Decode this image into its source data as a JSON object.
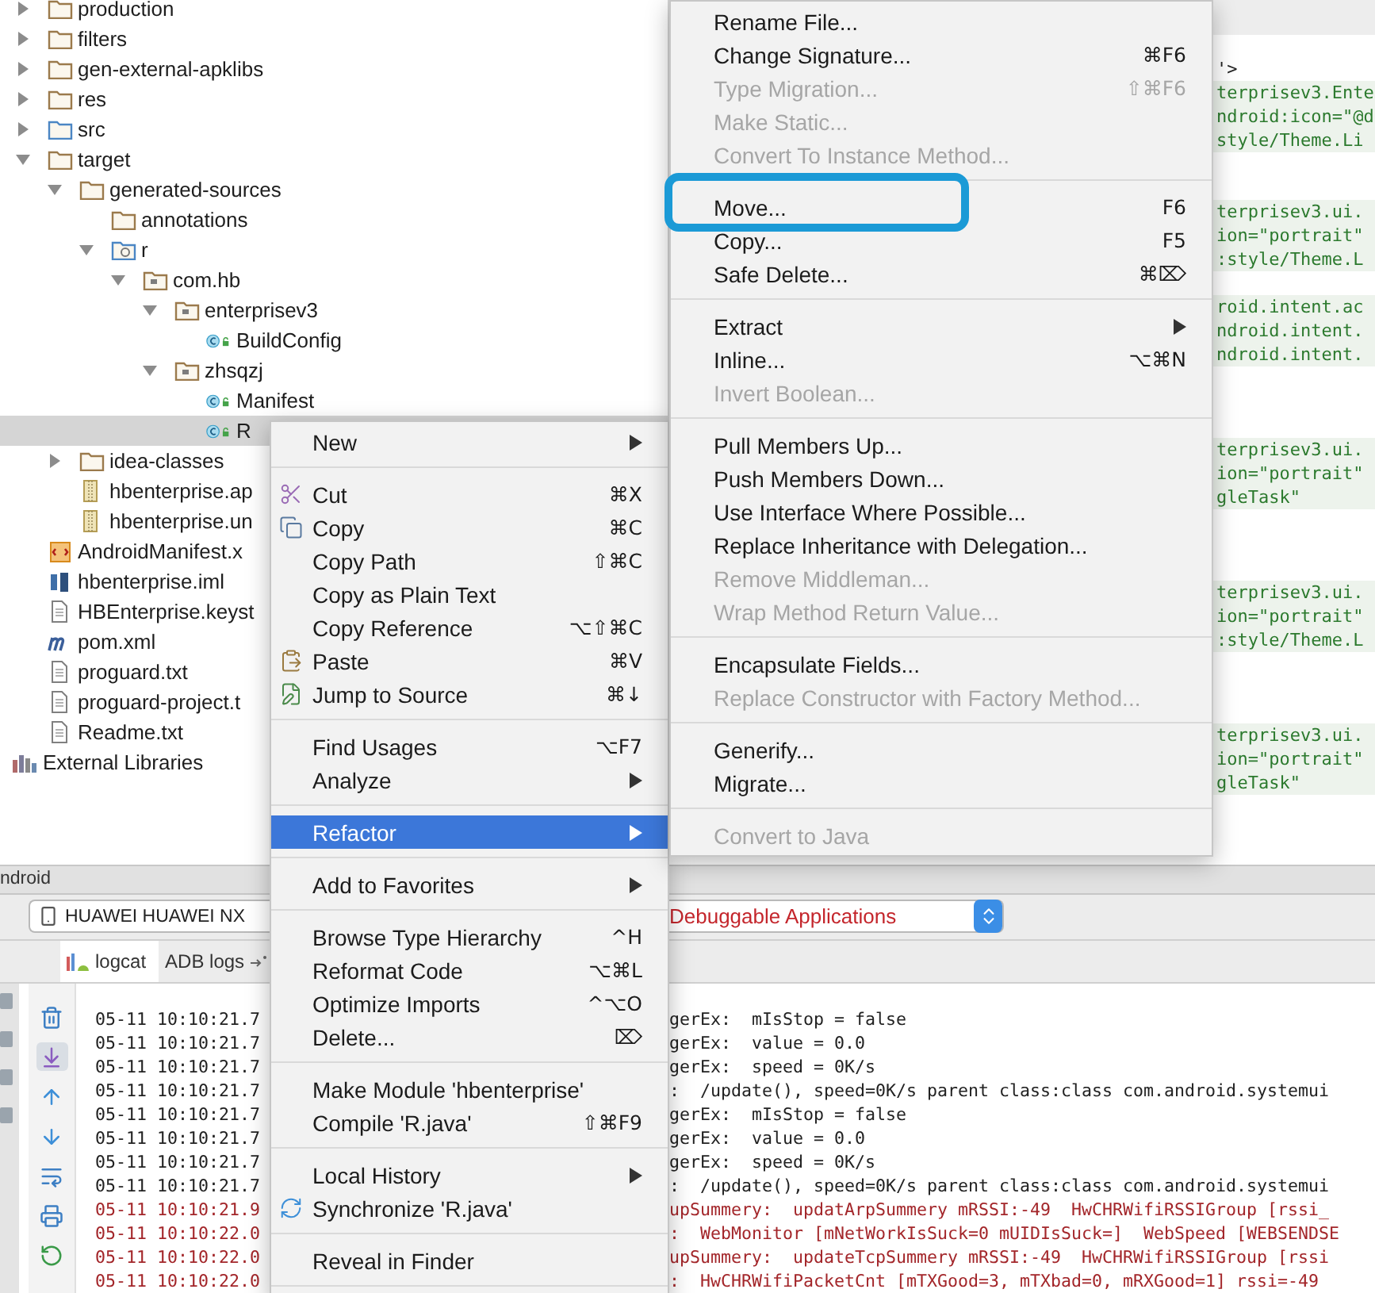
{
  "tree": [
    {
      "label": "production",
      "kind": "folder",
      "expanded": false,
      "selected": false
    },
    {
      "label": "filters",
      "kind": "folder",
      "expanded": false,
      "selected": false
    },
    {
      "label": "gen-external-apklibs",
      "kind": "folder",
      "expanded": false,
      "selected": false
    },
    {
      "label": "res",
      "kind": "folder",
      "expanded": false,
      "selected": false
    },
    {
      "label": "src",
      "kind": "source-folder",
      "expanded": false,
      "selected": false
    },
    {
      "label": "target",
      "kind": "folder",
      "expanded": true,
      "selected": false,
      "children": [
        {
          "label": "generated-sources",
          "kind": "folder",
          "expanded": true,
          "selected": false,
          "children": [
            {
              "label": "annotations",
              "kind": "folder",
              "selected": false
            },
            {
              "label": "r",
              "kind": "generated-folder",
              "expanded": true,
              "selected": false,
              "children": [
                {
                  "label": "com.hb",
                  "kind": "package",
                  "expanded": true,
                  "selected": false,
                  "children": [
                    {
                      "label": "enterprisev3",
                      "kind": "package",
                      "expanded": true,
                      "selected": false,
                      "children": [
                        {
                          "label": "BuildConfig",
                          "kind": "class",
                          "selected": false
                        }
                      ]
                    },
                    {
                      "label": "zhsqzj",
                      "kind": "package",
                      "expanded": true,
                      "selected": false,
                      "children": [
                        {
                          "label": "Manifest",
                          "kind": "class",
                          "selected": false
                        },
                        {
                          "label": "R",
                          "kind": "class",
                          "selected": true
                        }
                      ]
                    }
                  ]
                }
              ]
            }
          ]
        },
        {
          "label": "idea-classes",
          "kind": "folder",
          "expanded": false,
          "selected": false
        },
        {
          "label": "hbenterprise.ap",
          "kind": "archive",
          "selected": false
        },
        {
          "label": "hbenterprise.un",
          "kind": "archive",
          "selected": false
        }
      ]
    },
    {
      "label": "AndroidManifest.x",
      "kind": "xml",
      "selected": false
    },
    {
      "label": "hbenterprise.iml",
      "kind": "module",
      "selected": false
    },
    {
      "label": "HBEnterprise.keyst",
      "kind": "file",
      "selected": false
    },
    {
      "label": "pom.xml",
      "kind": "maven",
      "selected": false
    },
    {
      "label": "proguard.txt",
      "kind": "file",
      "selected": false
    },
    {
      "label": "proguard-project.t",
      "kind": "file",
      "selected": false
    },
    {
      "label": "Readme.txt",
      "kind": "file",
      "selected": false
    }
  ],
  "libraries": {
    "label": "External Libraries"
  },
  "editor": {
    "lines": [
      {
        "kind": "plain",
        "text": "'>"
      },
      {
        "kind": "code",
        "text": "terprisev3.Ente"
      },
      {
        "kind": "code",
        "text": "ndroid:icon=\"@d"
      },
      {
        "kind": "code",
        "text": "style/Theme.Li"
      },
      {
        "kind": "blank"
      },
      {
        "kind": "blank"
      },
      {
        "kind": "code",
        "text": "terprisev3.ui."
      },
      {
        "kind": "code",
        "text": "ion=\"portrait\""
      },
      {
        "kind": "code",
        "text": ":style/Theme.L"
      },
      {
        "kind": "blank"
      },
      {
        "kind": "code",
        "text": "roid.intent.ac"
      },
      {
        "kind": "code",
        "text": "ndroid.intent."
      },
      {
        "kind": "code",
        "text": "ndroid.intent."
      },
      {
        "kind": "blank"
      },
      {
        "kind": "blank"
      },
      {
        "kind": "blank"
      },
      {
        "kind": "code",
        "text": "terprisev3.ui."
      },
      {
        "kind": "code",
        "text": "ion=\"portrait\""
      },
      {
        "kind": "code",
        "text": "gleTask\""
      },
      {
        "kind": "blank"
      },
      {
        "kind": "blank"
      },
      {
        "kind": "blank"
      },
      {
        "kind": "code",
        "text": "terprisev3.ui."
      },
      {
        "kind": "code",
        "text": "ion=\"portrait\""
      },
      {
        "kind": "code",
        "text": ":style/Theme.L"
      },
      {
        "kind": "blank"
      },
      {
        "kind": "blank"
      },
      {
        "kind": "blank"
      },
      {
        "kind": "code",
        "text": "terprisev3.ui."
      },
      {
        "kind": "code",
        "text": "ion=\"portrait\""
      },
      {
        "kind": "code",
        "text": "gleTask\""
      }
    ]
  },
  "android_panel": {
    "title": "ndroid",
    "device": "HUAWEI HUAWEI NX",
    "process_filter": "Debuggable Applications",
    "tabs": [
      {
        "label": "logcat",
        "selected": true
      },
      {
        "label": "ADB logs",
        "selected": false
      }
    ],
    "log": [
      {
        "time": "05-11 10:10:21.7",
        "message": "gerEx:  mIsStop = false",
        "color": "#222222"
      },
      {
        "time": "05-11 10:10:21.7",
        "message": "gerEx:  value = 0.0",
        "color": "#222222"
      },
      {
        "time": "05-11 10:10:21.7",
        "message": "gerEx:  speed = 0K/s",
        "color": "#222222"
      },
      {
        "time": "05-11 10:10:21.7",
        "message": ":  /update(), speed=0K/s parent class:class com.android.systemui",
        "color": "#222222"
      },
      {
        "time": "05-11 10:10:21.7",
        "message": "gerEx:  mIsStop = false",
        "color": "#222222"
      },
      {
        "time": "05-11 10:10:21.7",
        "message": "gerEx:  value = 0.0",
        "color": "#222222"
      },
      {
        "time": "05-11 10:10:21.7",
        "message": "gerEx:  speed = 0K/s",
        "color": "#222222"
      },
      {
        "time": "05-11 10:10:21.7",
        "message": ":  /update(), speed=0K/s parent class:class com.android.systemui",
        "color": "#222222"
      },
      {
        "time": "05-11 10:10:21.9",
        "message": "upSummery:  updatArpSummery mRSSI:-49  HwCHRWifiRSSIGroup [rssi_",
        "color": "#a3262a"
      },
      {
        "time": "05-11 10:10:22.0",
        "message": ":  WebMonitor [mNetWorkIsSuck=0 mUIDIsSuck=]  WebSpeed [WEBSENDSE",
        "color": "#a3262a"
      },
      {
        "time": "05-11 10:10:22.0",
        "message": "upSummery:  updateTcpSummery mRSSI:-49  HwCHRWifiRSSIGroup [rssi",
        "color": "#a3262a"
      },
      {
        "time": "05-11 10:10:22.0",
        "message": ":  HwCHRWifiPacketCnt [mTXGood=3, mTXbad=0, mRXGood=1] rssi=-49",
        "color": "#a3262a"
      }
    ]
  },
  "context_menu": [
    {
      "kind": "item",
      "label": "New",
      "submenu": true,
      "selected": false
    },
    {
      "kind": "separator"
    },
    {
      "kind": "cut",
      "label": "Cut",
      "shortcut": "⌘X",
      "submenu": false,
      "selected": false
    },
    {
      "kind": "copy",
      "label": "Copy",
      "shortcut": "⌘C",
      "submenu": false,
      "selected": false
    },
    {
      "kind": "item",
      "label": "Copy Path",
      "shortcut": "⇧⌘C",
      "submenu": false,
      "selected": false
    },
    {
      "kind": "item",
      "label": "Copy as Plain Text",
      "submenu": false,
      "selected": false
    },
    {
      "kind": "item",
      "label": "Copy Reference",
      "shortcut": "⌥⇧⌘C",
      "submenu": false,
      "selected": false
    },
    {
      "kind": "paste",
      "label": "Paste",
      "shortcut": "⌘V",
      "submenu": false,
      "selected": false
    },
    {
      "kind": "jump",
      "label": "Jump to Source",
      "shortcut": "⌘↓",
      "submenu": false,
      "selected": false
    },
    {
      "kind": "separator"
    },
    {
      "kind": "item",
      "label": "Find Usages",
      "shortcut": "⌥F7",
      "submenu": false,
      "selected": false
    },
    {
      "kind": "item",
      "label": "Analyze",
      "submenu": true,
      "selected": false
    },
    {
      "kind": "separator"
    },
    {
      "kind": "item",
      "label": "Refactor",
      "submenu": true,
      "selected": true
    },
    {
      "kind": "separator"
    },
    {
      "kind": "item",
      "label": "Add to Favorites",
      "submenu": true,
      "selected": false
    },
    {
      "kind": "separator"
    },
    {
      "kind": "item",
      "label": "Browse Type Hierarchy",
      "shortcut": "^H",
      "submenu": false,
      "selected": false
    },
    {
      "kind": "item",
      "label": "Reformat Code",
      "shortcut": "⌥⌘L",
      "submenu": false,
      "selected": false
    },
    {
      "kind": "item",
      "label": "Optimize Imports",
      "shortcut": "^⌥O",
      "submenu": false,
      "selected": false
    },
    {
      "kind": "item",
      "label": "Delete...",
      "shortcut": "⌦",
      "submenu": false,
      "selected": false
    },
    {
      "kind": "separator"
    },
    {
      "kind": "item",
      "label": "Make Module 'hbenterprise'",
      "submenu": false,
      "selected": false
    },
    {
      "kind": "item",
      "label": "Compile 'R.java'",
      "shortcut": "⇧⌘F9",
      "submenu": false,
      "selected": false
    },
    {
      "kind": "separator"
    },
    {
      "kind": "item",
      "label": "Local History",
      "submenu": true,
      "selected": false
    },
    {
      "kind": "sync",
      "label": "Synchronize 'R.java'",
      "submenu": false,
      "selected": false
    },
    {
      "kind": "separator"
    },
    {
      "kind": "item",
      "label": "Reveal in Finder",
      "submenu": false,
      "selected": false
    },
    {
      "kind": "separator"
    }
  ],
  "refactor_submenu": [
    {
      "kind": "item",
      "label": "Rename File...",
      "disabled": false,
      "outlined": false,
      "submenu": false
    },
    {
      "kind": "item",
      "label": "Change Signature...",
      "shortcut": "⌘F6",
      "disabled": false,
      "outlined": false,
      "submenu": false
    },
    {
      "kind": "item",
      "label": "Type Migration...",
      "shortcut": "⇧⌘F6",
      "disabled": true,
      "outlined": false,
      "submenu": false
    },
    {
      "kind": "item",
      "label": "Make Static...",
      "disabled": true,
      "outlined": false,
      "submenu": false
    },
    {
      "kind": "item",
      "label": "Convert To Instance Method...",
      "disabled": true,
      "outlined": false,
      "submenu": false
    },
    {
      "kind": "separator"
    },
    {
      "kind": "item",
      "label": "Move...",
      "shortcut": "F6",
      "disabled": false,
      "outlined": true,
      "submenu": false
    },
    {
      "kind": "item",
      "label": "Copy...",
      "shortcut": "F5",
      "disabled": false,
      "outlined": false,
      "submenu": false
    },
    {
      "kind": "item",
      "label": "Safe Delete...",
      "shortcut": "⌘⌦",
      "disabled": false,
      "outlined": false,
      "submenu": false
    },
    {
      "kind": "separator"
    },
    {
      "kind": "item",
      "label": "Extract",
      "disabled": false,
      "outlined": false,
      "submenu": true
    },
    {
      "kind": "item",
      "label": "Inline...",
      "shortcut": "⌥⌘N",
      "disabled": false,
      "outlined": false,
      "submenu": false
    },
    {
      "kind": "item",
      "label": "Invert Boolean...",
      "disabled": true,
      "outlined": false,
      "submenu": false
    },
    {
      "kind": "separator"
    },
    {
      "kind": "item",
      "label": "Pull Members Up...",
      "disabled": false,
      "outlined": false,
      "submenu": false
    },
    {
      "kind": "item",
      "label": "Push Members Down...",
      "disabled": false,
      "outlined": false,
      "submenu": false
    },
    {
      "kind": "item",
      "label": "Use Interface Where Possible...",
      "disabled": false,
      "outlined": false,
      "submenu": false
    },
    {
      "kind": "item",
      "label": "Replace Inheritance with Delegation...",
      "disabled": false,
      "outlined": false,
      "submenu": false
    },
    {
      "kind": "item",
      "label": "Remove Middleman...",
      "disabled": true,
      "outlined": false,
      "submenu": false
    },
    {
      "kind": "item",
      "label": "Wrap Method Return Value...",
      "disabled": true,
      "outlined": false,
      "submenu": false
    },
    {
      "kind": "separator"
    },
    {
      "kind": "item",
      "label": "Encapsulate Fields...",
      "disabled": false,
      "outlined": false,
      "submenu": false
    },
    {
      "kind": "item",
      "label": "Replace Constructor with Factory Method...",
      "disabled": true,
      "outlined": false,
      "submenu": false
    },
    {
      "kind": "separator"
    },
    {
      "kind": "item",
      "label": "Generify...",
      "disabled": false,
      "outlined": false,
      "submenu": false
    },
    {
      "kind": "item",
      "label": "Migrate...",
      "disabled": false,
      "outlined": false,
      "submenu": false
    },
    {
      "kind": "separator"
    },
    {
      "kind": "item",
      "label": "Convert to Java",
      "disabled": true,
      "outlined": false,
      "submenu": false
    }
  ]
}
